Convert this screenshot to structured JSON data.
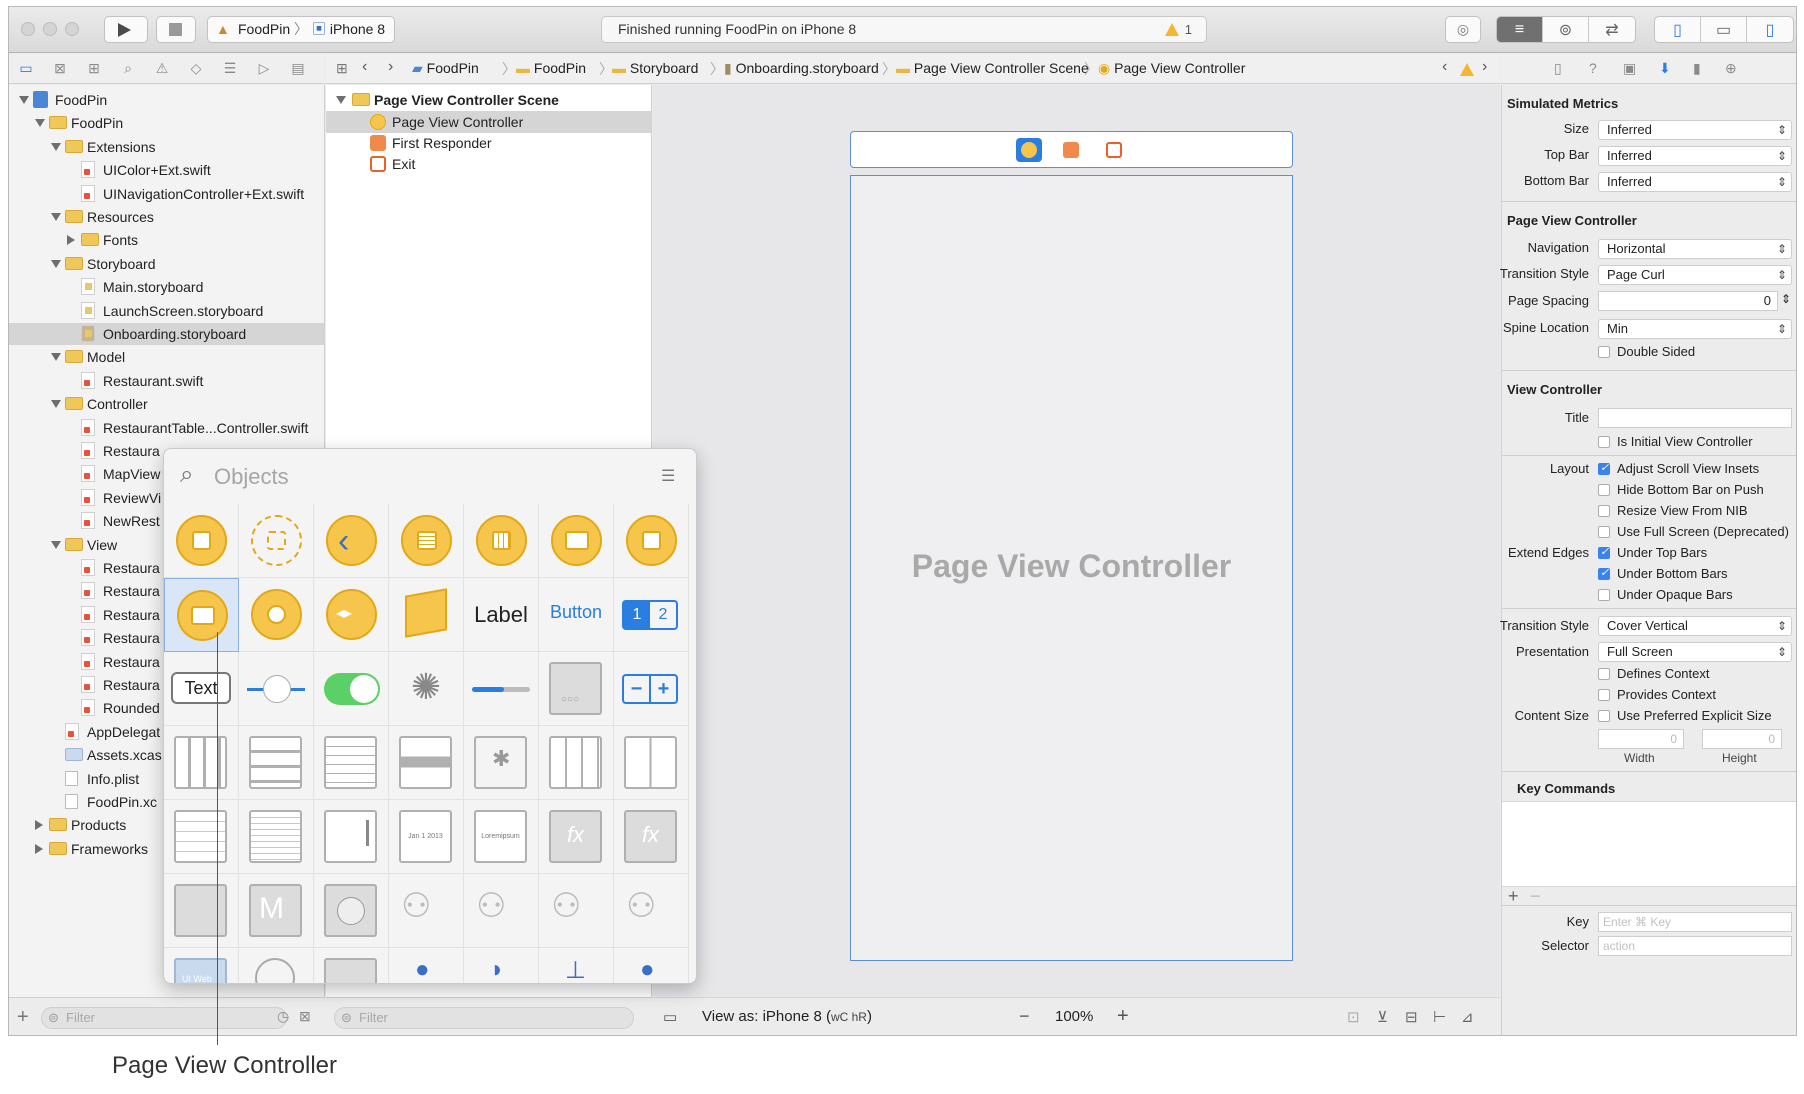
{
  "toolbar": {
    "scheme_app": "FoodPin",
    "scheme_device": "iPhone 8",
    "status_text": "Finished running FoodPin on iPhone 8",
    "warning_count": "1"
  },
  "navigator": {
    "tree": [
      {
        "label": "FoodPin",
        "depth": 0,
        "kind": "project",
        "disclosure": "open"
      },
      {
        "label": "FoodPin",
        "depth": 1,
        "kind": "folder",
        "disclosure": "open"
      },
      {
        "label": "Extensions",
        "depth": 2,
        "kind": "folder",
        "disclosure": "open"
      },
      {
        "label": "UIColor+Ext.swift",
        "depth": 3,
        "kind": "swift"
      },
      {
        "label": "UINavigationController+Ext.swift",
        "depth": 3,
        "kind": "swift"
      },
      {
        "label": "Resources",
        "depth": 2,
        "kind": "folder",
        "disclosure": "open"
      },
      {
        "label": "Fonts",
        "depth": 3,
        "kind": "folder",
        "disclosure": "closed"
      },
      {
        "label": "Storyboard",
        "depth": 2,
        "kind": "folder",
        "disclosure": "open"
      },
      {
        "label": "Main.storyboard",
        "depth": 3,
        "kind": "storyboard"
      },
      {
        "label": "LaunchScreen.storyboard",
        "depth": 3,
        "kind": "storyboard"
      },
      {
        "label": "Onboarding.storyboard",
        "depth": 3,
        "kind": "storyboard-dark",
        "selected": true
      },
      {
        "label": "Model",
        "depth": 2,
        "kind": "folder",
        "disclosure": "open"
      },
      {
        "label": "Restaurant.swift",
        "depth": 3,
        "kind": "swift"
      },
      {
        "label": "Controller",
        "depth": 2,
        "kind": "folder",
        "disclosure": "open"
      },
      {
        "label": "RestaurantTable...Controller.swift",
        "depth": 3,
        "kind": "swift"
      },
      {
        "label": "Restaura",
        "depth": 3,
        "kind": "swift"
      },
      {
        "label": "MapView",
        "depth": 3,
        "kind": "swift"
      },
      {
        "label": "ReviewVi",
        "depth": 3,
        "kind": "swift"
      },
      {
        "label": "NewRest",
        "depth": 3,
        "kind": "swift"
      },
      {
        "label": "View",
        "depth": 2,
        "kind": "folder",
        "disclosure": "open"
      },
      {
        "label": "Restaura",
        "depth": 3,
        "kind": "swift"
      },
      {
        "label": "Restaura",
        "depth": 3,
        "kind": "swift"
      },
      {
        "label": "Restaura",
        "depth": 3,
        "kind": "swift"
      },
      {
        "label": "Restaura",
        "depth": 3,
        "kind": "swift"
      },
      {
        "label": "Restaura",
        "depth": 3,
        "kind": "swift"
      },
      {
        "label": "Restaura",
        "depth": 3,
        "kind": "swift"
      },
      {
        "label": "Rounded",
        "depth": 3,
        "kind": "swift"
      },
      {
        "label": "AppDelegat",
        "depth": 2,
        "kind": "swift"
      },
      {
        "label": "Assets.xcas",
        "depth": 2,
        "kind": "folder-blue"
      },
      {
        "label": "Info.plist",
        "depth": 2,
        "kind": "plist"
      },
      {
        "label": "FoodPin.xc",
        "depth": 2,
        "kind": "plist"
      },
      {
        "label": "Products",
        "depth": 1,
        "kind": "folder",
        "disclosure": "closed"
      },
      {
        "label": "Frameworks",
        "depth": 1,
        "kind": "folder",
        "disclosure": "closed"
      }
    ],
    "filter_placeholder": "Filter"
  },
  "jumpbar": {
    "crumbs": [
      "FoodPin",
      "FoodPin",
      "Storyboard",
      "Onboarding.storyboard",
      "Page View Controller Scene",
      "Page View Controller"
    ]
  },
  "outline": {
    "scene_title": "Page View Controller Scene",
    "items": [
      "Page View Controller",
      "First Responder",
      "Exit"
    ],
    "filter_placeholder": "Filter"
  },
  "canvas": {
    "scene_label": "Page View Controller",
    "view_as": "View as: iPhone 8 (",
    "view_as_size": "wC hR",
    "zoom": "100%"
  },
  "inspector": {
    "simulated_metrics": {
      "header": "Simulated Metrics",
      "size_label": "Size",
      "size_value": "Inferred",
      "topbar_label": "Top Bar",
      "topbar_value": "Inferred",
      "bottombar_label": "Bottom Bar",
      "bottombar_value": "Inferred"
    },
    "page_view_controller": {
      "header": "Page View Controller",
      "navigation_label": "Navigation",
      "navigation_value": "Horizontal",
      "transition_label": "Transition Style",
      "transition_value": "Page Curl",
      "spacing_label": "Page Spacing",
      "spacing_value": "0",
      "spine_label": "Spine Location",
      "spine_value": "Min",
      "double_sided": "Double Sided"
    },
    "view_controller": {
      "header": "View Controller",
      "title_label": "Title",
      "is_initial": "Is Initial View Controller",
      "layout_label": "Layout",
      "adjust_insets": "Adjust Scroll View Insets",
      "hide_bottom": "Hide Bottom Bar on Push",
      "resize_nib": "Resize View From NIB",
      "full_screen": "Use Full Screen (Deprecated)",
      "extend_label": "Extend Edges",
      "under_top": "Under Top Bars",
      "under_bottom": "Under Bottom Bars",
      "under_opaque": "Under Opaque Bars",
      "vc_transition_label": "Transition Style",
      "vc_transition_value": "Cover Vertical",
      "presentation_label": "Presentation",
      "presentation_value": "Full Screen",
      "defines_context": "Defines Context",
      "provides_context": "Provides Context",
      "content_size_label": "Content Size",
      "preferred_size": "Use Preferred Explicit Size",
      "width_value": "0",
      "height_value": "0",
      "width_label": "Width",
      "height_label": "Height"
    },
    "key_commands": {
      "header": "Key Commands",
      "key_label": "Key",
      "key_placeholder": "Enter ⌘ Key",
      "selector_label": "Selector",
      "selector_placeholder": "action"
    }
  },
  "library": {
    "search_placeholder": "Objects",
    "label_text": "Label",
    "button_text": "Button",
    "seg_1": "1",
    "seg_2": "2",
    "textfield_text": "Text",
    "stepper_minus": "−",
    "stepper_plus": "+",
    "fx": "fx",
    "uiweb": "UI Web"
  },
  "callout": {
    "text": "Page View Controller"
  },
  "colors": {
    "accent": "#2a7de1",
    "library_yellow": "#f6c54b",
    "warning": "#f3b632"
  }
}
